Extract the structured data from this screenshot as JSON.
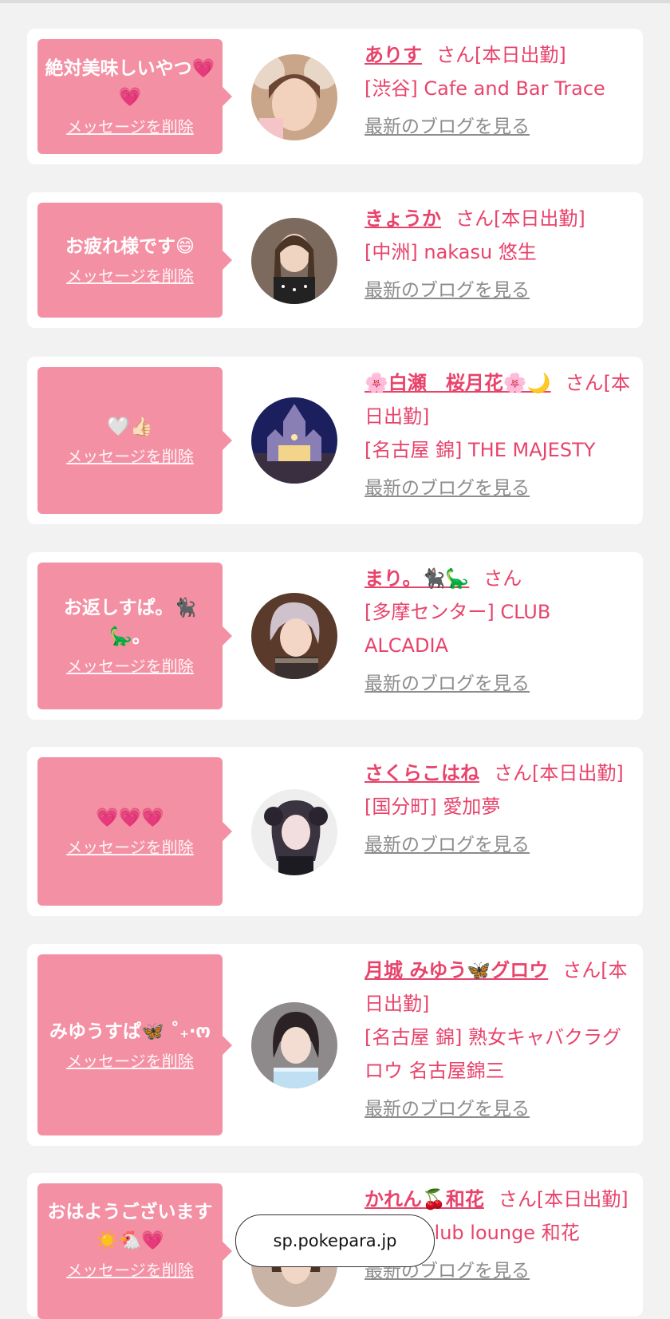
{
  "colors": {
    "accent": "#e8436b",
    "bubble": "#f490a4",
    "background": "#f2f2f2",
    "link_gray": "#8c8c8c"
  },
  "address_bar": {
    "url": "sp.pokepara.jp"
  },
  "items": [
    {
      "message": "絶対美味しいやつ💗💗",
      "delete_label": "メッセージを削除",
      "name": "ありす",
      "suffix": "さん[本日出勤]",
      "store": "[渋谷] Cafe and Bar Trace",
      "blog_label": "最新のブログを見る"
    },
    {
      "message": "お疲れ様です😄",
      "delete_label": "メッセージを削除",
      "name": "きょうか",
      "suffix": "さん[本日出勤]",
      "store": "[中洲] nakasu 悠生",
      "blog_label": "最新のブログを見る"
    },
    {
      "message": "🤍👍🏻",
      "delete_label": "メッセージを削除",
      "name": "🌸白瀬　桜月花🌸🌙",
      "suffix": "さん[本日出勤]",
      "store": "[名古屋 錦] THE MAJESTY",
      "blog_label": "最新のブログを見る"
    },
    {
      "message": "お返しすぱ。🐈‍⬛🦕。",
      "delete_label": "メッセージを削除",
      "name": "まり。🐈‍⬛🦕",
      "suffix": "さん",
      "store": "[多摩センター] CLUB ALCADIA",
      "blog_label": "最新のブログを見る"
    },
    {
      "message": "💗💗💗",
      "delete_label": "メッセージを削除",
      "name": "さくらこはね",
      "suffix": "さん[本日出勤]",
      "store": "[国分町] 愛加夢",
      "blog_label": "最新のブログを見る"
    },
    {
      "message": "みゆうすぱ🦋 ˚₊‧ო",
      "delete_label": "メッセージを削除",
      "name": "月城 みゆう🦋グロウ",
      "suffix": "さん[本日出勤]",
      "store": "[名古屋 錦] 熟女キャバクラグロウ 名古屋錦三",
      "blog_label": "最新のブログを見る"
    },
    {
      "message": "おはようございます☀️🐔💗",
      "delete_label": "メッセージを削除",
      "name": "かれん🍒和花",
      "suffix": "さん[本日出勤]",
      "store": "[湯島] club lounge 和花",
      "blog_label": "最新のブログを見る"
    }
  ]
}
